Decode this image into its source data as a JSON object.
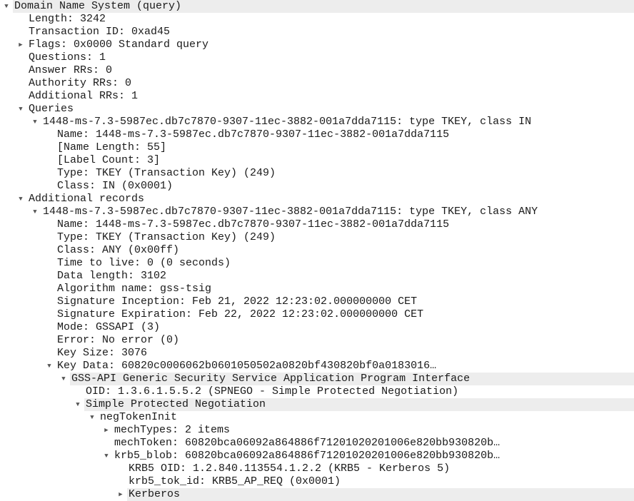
{
  "rows": [
    {
      "depth": 0,
      "toggle": "expanded",
      "highlight": true,
      "text": "Domain Name System (query)"
    },
    {
      "depth": 1,
      "toggle": "none",
      "text": "Length: 3242"
    },
    {
      "depth": 1,
      "toggle": "none",
      "text": "Transaction ID: 0xad45"
    },
    {
      "depth": 1,
      "toggle": "collapsed",
      "text": "Flags: 0x0000 Standard query"
    },
    {
      "depth": 1,
      "toggle": "none",
      "text": "Questions: 1"
    },
    {
      "depth": 1,
      "toggle": "none",
      "text": "Answer RRs: 0"
    },
    {
      "depth": 1,
      "toggle": "none",
      "text": "Authority RRs: 0"
    },
    {
      "depth": 1,
      "toggle": "none",
      "text": "Additional RRs: 1"
    },
    {
      "depth": 1,
      "toggle": "expanded",
      "text": "Queries"
    },
    {
      "depth": 2,
      "toggle": "expanded",
      "text": "1448-ms-7.3-5987ec.db7c7870-9307-11ec-3882-001a7dda7115: type TKEY, class IN"
    },
    {
      "depth": 3,
      "toggle": "none",
      "text": "Name: 1448-ms-7.3-5987ec.db7c7870-9307-11ec-3882-001a7dda7115"
    },
    {
      "depth": 3,
      "toggle": "none",
      "text": "[Name Length: 55]"
    },
    {
      "depth": 3,
      "toggle": "none",
      "text": "[Label Count: 3]"
    },
    {
      "depth": 3,
      "toggle": "none",
      "text": "Type: TKEY (Transaction Key) (249)"
    },
    {
      "depth": 3,
      "toggle": "none",
      "text": "Class: IN (0x0001)"
    },
    {
      "depth": 1,
      "toggle": "expanded",
      "text": "Additional records"
    },
    {
      "depth": 2,
      "toggle": "expanded",
      "text": "1448-ms-7.3-5987ec.db7c7870-9307-11ec-3882-001a7dda7115: type TKEY, class ANY"
    },
    {
      "depth": 3,
      "toggle": "none",
      "text": "Name: 1448-ms-7.3-5987ec.db7c7870-9307-11ec-3882-001a7dda7115"
    },
    {
      "depth": 3,
      "toggle": "none",
      "text": "Type: TKEY (Transaction Key) (249)"
    },
    {
      "depth": 3,
      "toggle": "none",
      "text": "Class: ANY (0x00ff)"
    },
    {
      "depth": 3,
      "toggle": "none",
      "text": "Time to live: 0 (0 seconds)"
    },
    {
      "depth": 3,
      "toggle": "none",
      "text": "Data length: 3102"
    },
    {
      "depth": 3,
      "toggle": "none",
      "text": "Algorithm name: gss-tsig"
    },
    {
      "depth": 3,
      "toggle": "none",
      "text": "Signature Inception: Feb 21, 2022 12:23:02.000000000 CET"
    },
    {
      "depth": 3,
      "toggle": "none",
      "text": "Signature Expiration: Feb 22, 2022 12:23:02.000000000 CET"
    },
    {
      "depth": 3,
      "toggle": "none",
      "text": "Mode: GSSAPI (3)"
    },
    {
      "depth": 3,
      "toggle": "none",
      "text": "Error: No error (0)"
    },
    {
      "depth": 3,
      "toggle": "none",
      "text": "Key Size: 3076"
    },
    {
      "depth": 3,
      "toggle": "expanded",
      "text": "Key Data: 60820c0006062b0601050502a0820bf430820bf0a0183016…"
    },
    {
      "depth": 4,
      "toggle": "expanded",
      "highlight": true,
      "text": "GSS-API Generic Security Service Application Program Interface"
    },
    {
      "depth": 5,
      "toggle": "none",
      "text": "OID: 1.3.6.1.5.5.2 (SPNEGO - Simple Protected Negotiation)"
    },
    {
      "depth": 5,
      "toggle": "expanded",
      "highlight": true,
      "text": "Simple Protected Negotiation"
    },
    {
      "depth": 6,
      "toggle": "expanded",
      "text": "negTokenInit"
    },
    {
      "depth": 7,
      "toggle": "collapsed",
      "text": "mechTypes: 2 items"
    },
    {
      "depth": 7,
      "toggle": "none",
      "text": "mechToken: 60820bca06092a864886f71201020201006e820bb930820b…"
    },
    {
      "depth": 7,
      "toggle": "expanded",
      "text": "krb5_blob: 60820bca06092a864886f71201020201006e820bb930820b…"
    },
    {
      "depth": 8,
      "toggle": "none",
      "text": "KRB5 OID: 1.2.840.113554.1.2.2 (KRB5 - Kerberos 5)"
    },
    {
      "depth": 8,
      "toggle": "none",
      "text": "krb5_tok_id: KRB5_AP_REQ (0x0001)"
    },
    {
      "depth": 8,
      "toggle": "collapsed",
      "highlight": true,
      "text": "Kerberos"
    }
  ],
  "toggles": {
    "expanded": "▼",
    "collapsed": "▶",
    "none": ""
  }
}
